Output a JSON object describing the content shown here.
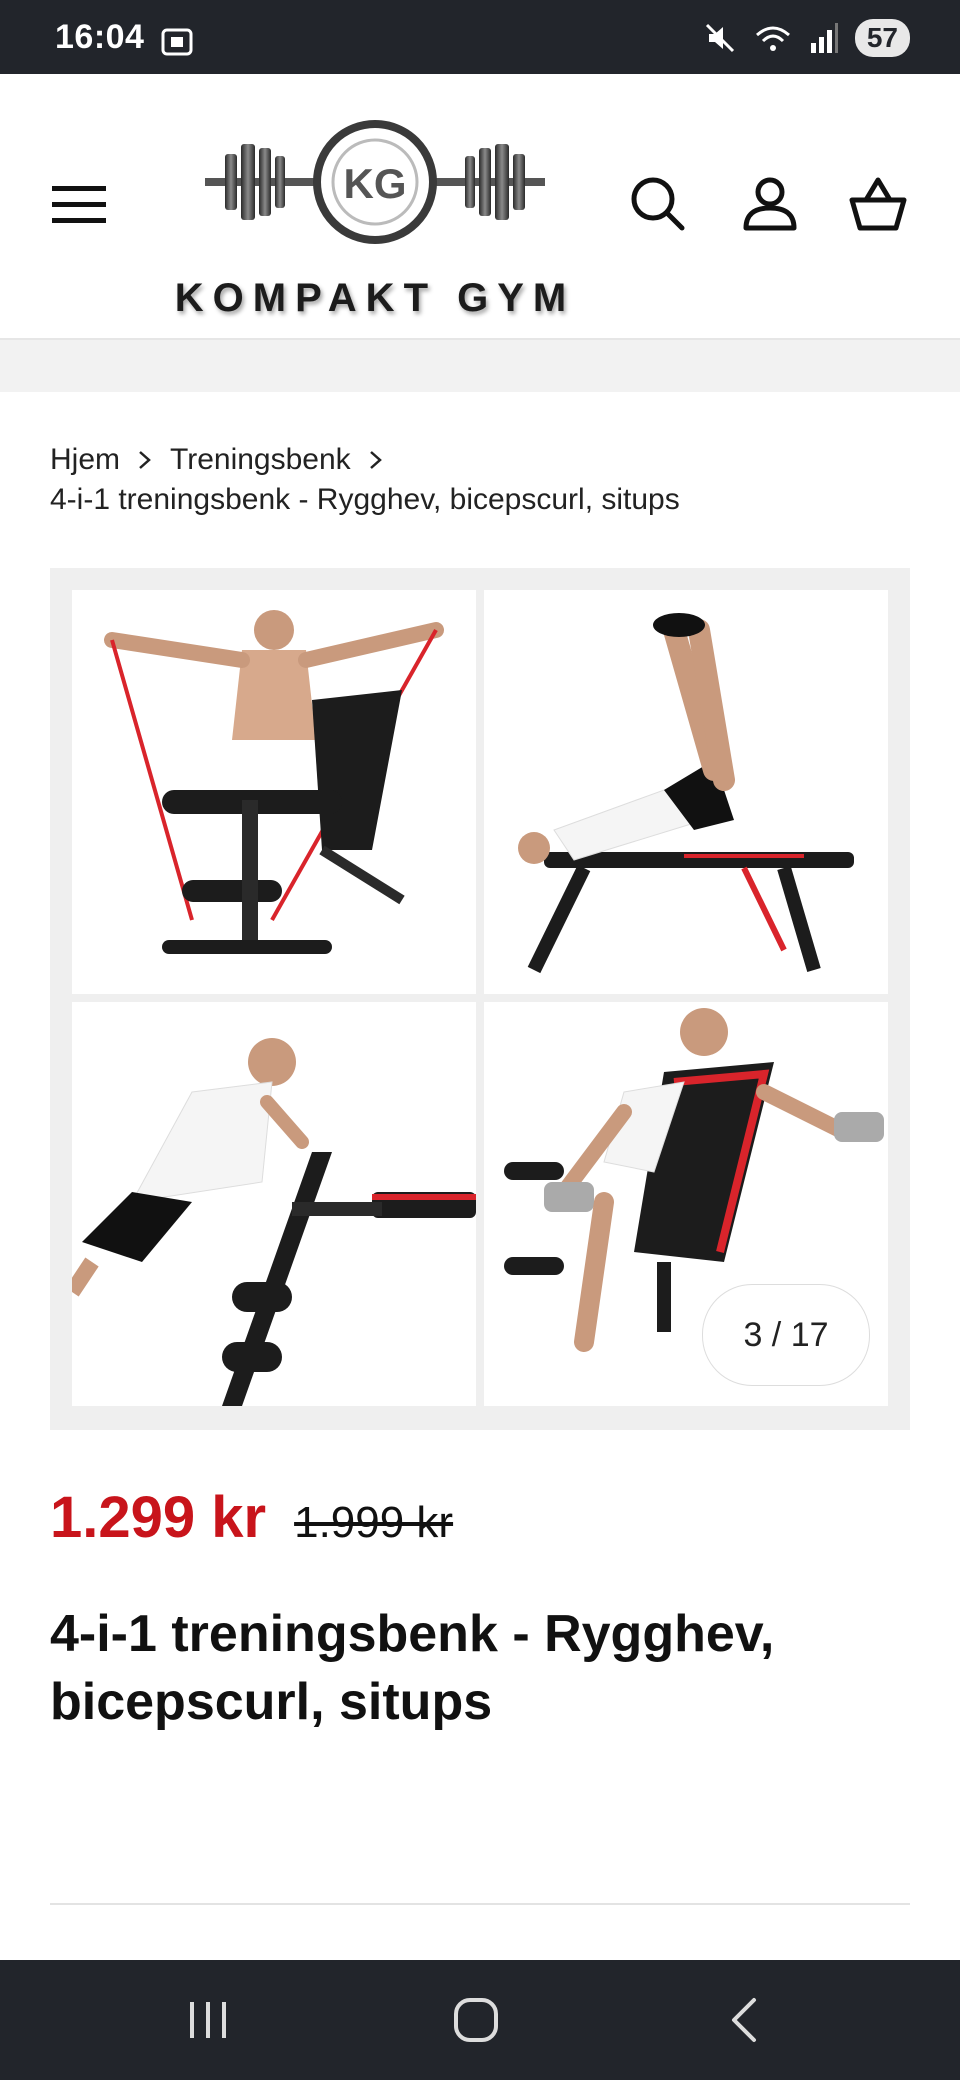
{
  "status": {
    "time": "16:04",
    "battery": "57"
  },
  "header": {
    "logo_text": "KOMPAKT GYM",
    "logo_monogram": "KG",
    "menu_icon": "hamburger-menu-icon",
    "search_icon": "search-icon",
    "account_icon": "user-icon",
    "cart_icon": "basket-icon"
  },
  "breadcrumb": {
    "home": "Hjem",
    "category": "Treningsbenk",
    "current": "4-i-1 treningsbenk - Rygghev, bicepscurl, situps"
  },
  "gallery": {
    "counter": "3 / 17"
  },
  "product": {
    "price": "1.299 kr",
    "compare_price": "1.999 kr",
    "title": "4-i-1 treningsbenk - Rygghev, bicepscurl, situps"
  },
  "colors": {
    "sale": "#c8141b",
    "bar": "#22252b"
  }
}
